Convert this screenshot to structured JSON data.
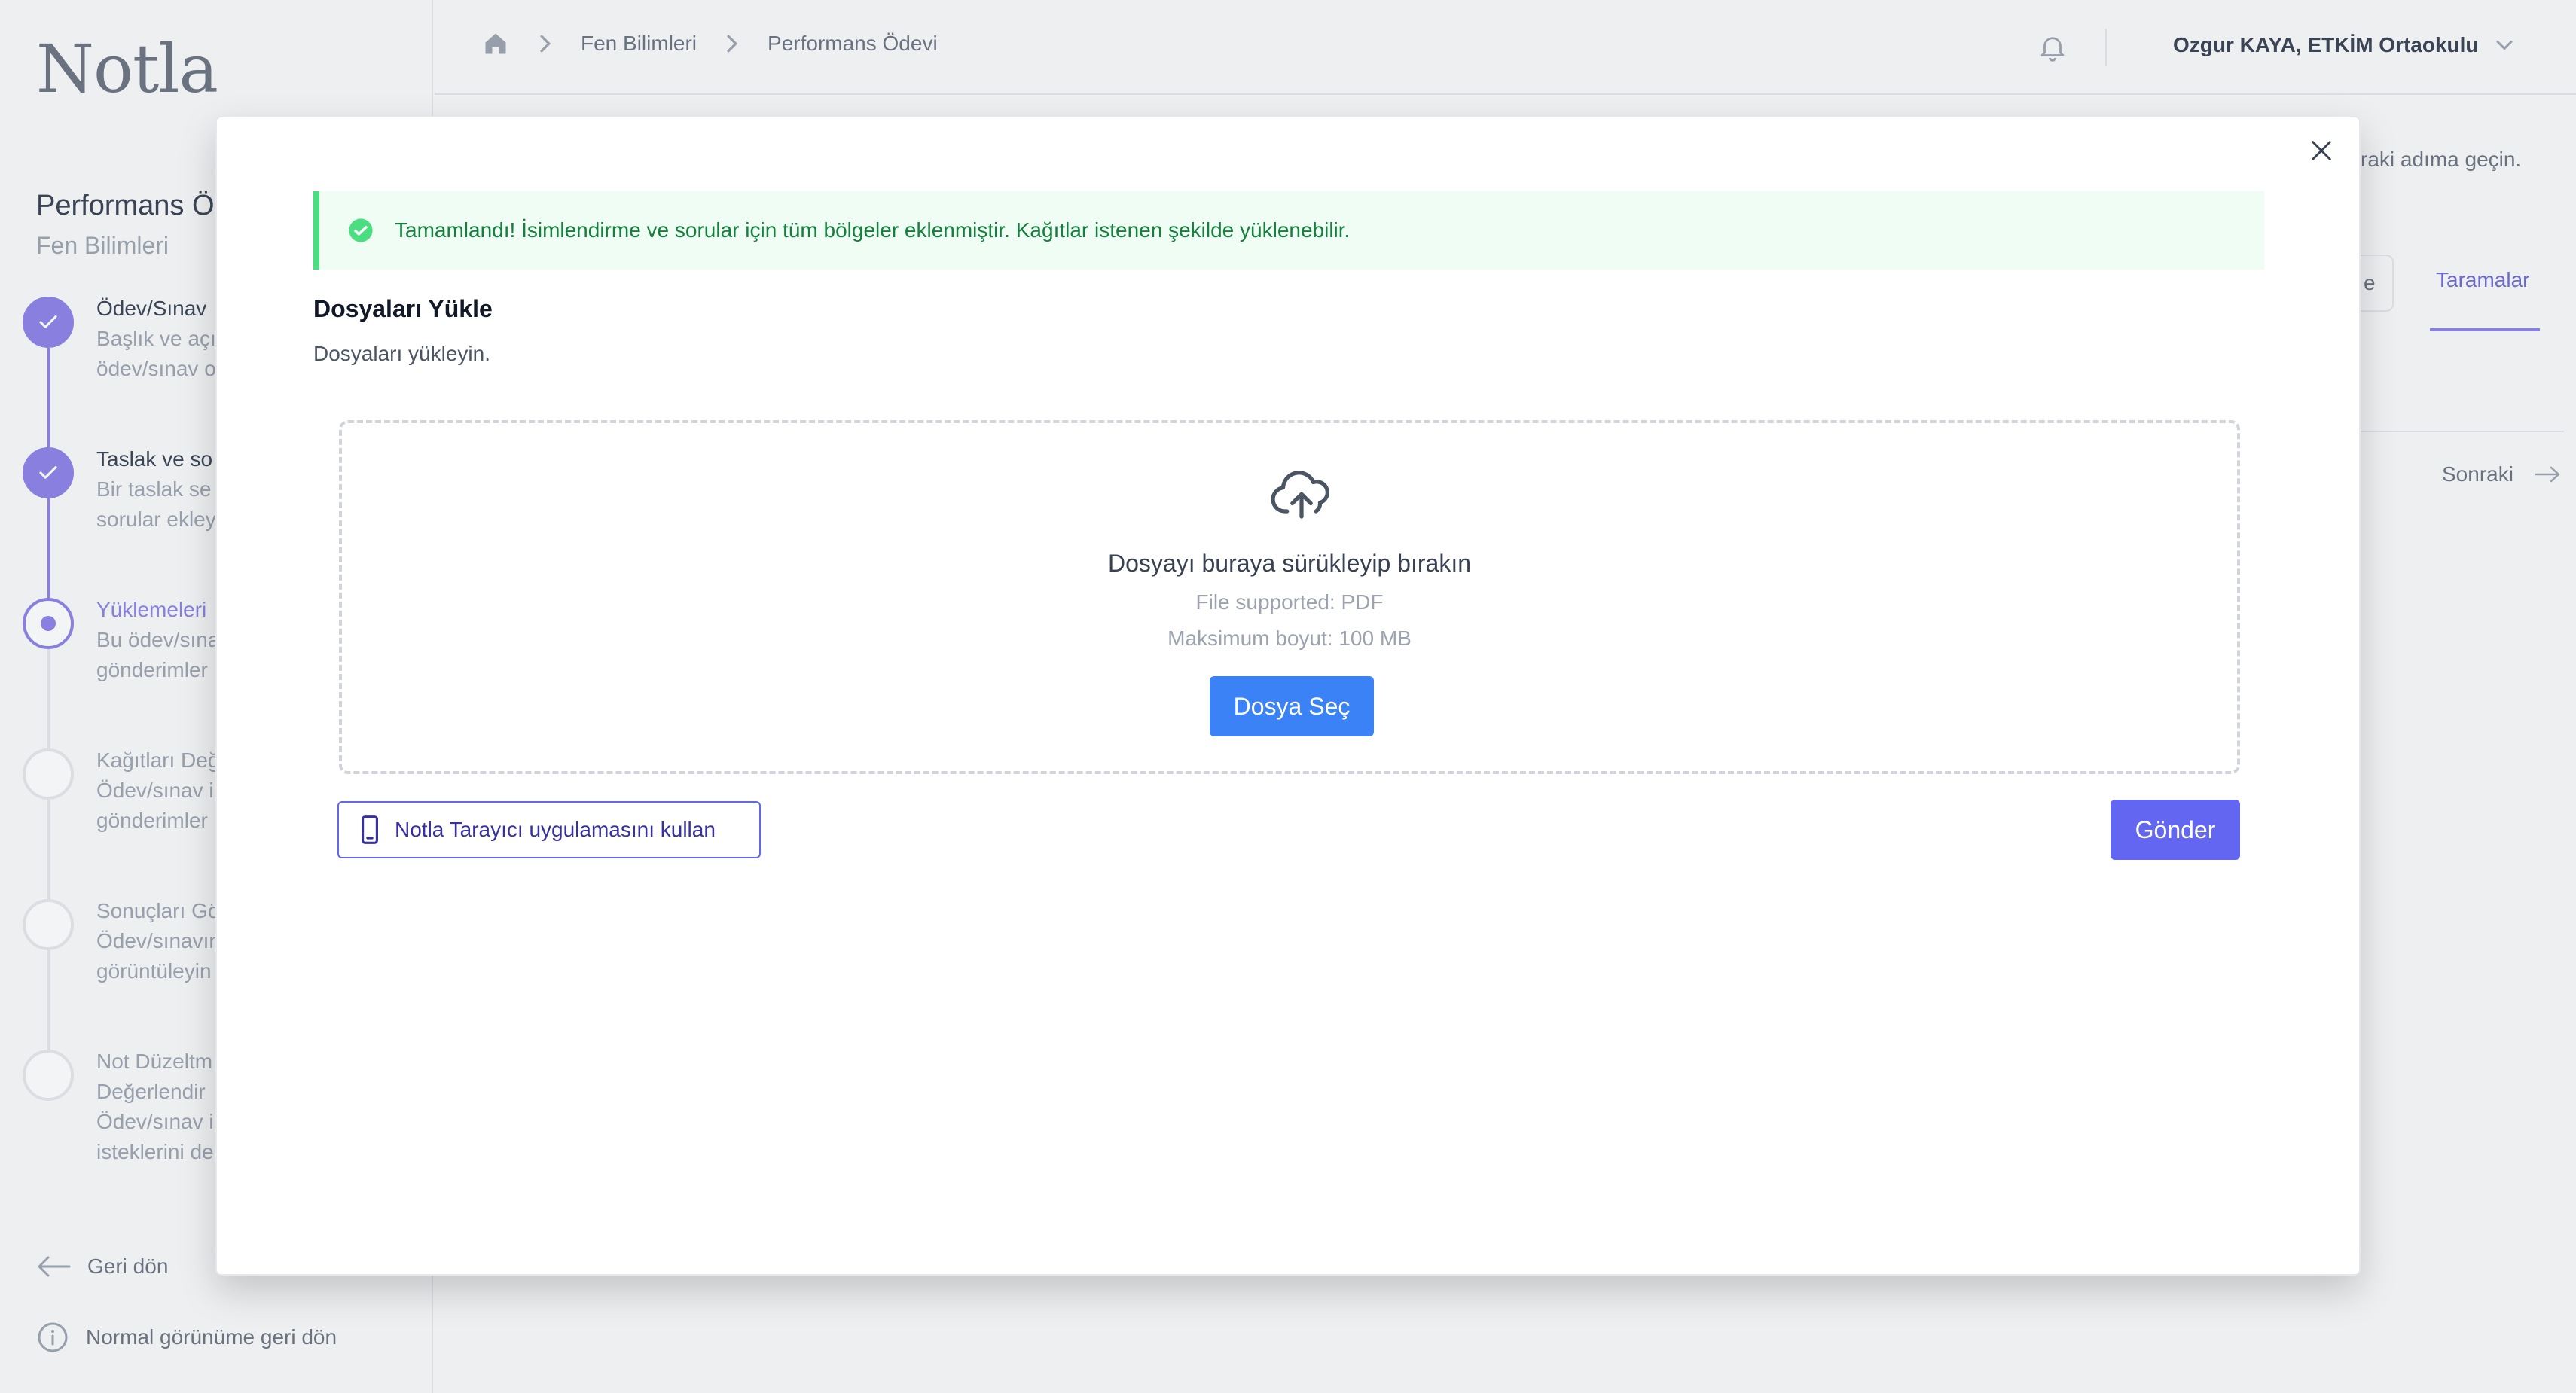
{
  "app": {
    "logo": "Notla"
  },
  "sidebar": {
    "title": "Performans Ödevi",
    "subtitle": "Fen Bilimleri",
    "steps": [
      {
        "name": "Ödev/Sınav",
        "desc1": "Başlık ve açı",
        "desc2": "ödev/sınav o",
        "status": "done"
      },
      {
        "name": "Taslak ve so",
        "desc1": "Bir taslak se",
        "desc2": "sorular ekley",
        "status": "done"
      },
      {
        "name": "Yüklemeleri",
        "desc1": "Bu ödev/sına",
        "desc2": "gönderimler",
        "status": "current"
      },
      {
        "name": "Kağıtları Değ",
        "desc1": "Ödev/sınav i",
        "desc2": "gönderimler",
        "status": "pending"
      },
      {
        "name": "Sonuçları Gö",
        "desc1": "Ödev/sınavın",
        "desc2": "görüntüleyin",
        "status": "pending"
      },
      {
        "name": "Not Düzeltm",
        "name2": "Değerlendir",
        "desc1": "Ödev/sınav i",
        "desc2": "isteklerini de",
        "status": "pending"
      }
    ],
    "back_label": "Geri dön",
    "normal_view_label": "Normal görünüme geri dön"
  },
  "header": {
    "breadcrumb": [
      "Fen Bilimleri",
      "Performans Ödevi"
    ],
    "user": "Ozgur KAYA, ETKİM Ortaokulu"
  },
  "background": {
    "hint": "raki adıma geçin.",
    "box_fragment": "e",
    "tab_label": "Taramalar",
    "next_label": "Sonraki"
  },
  "modal": {
    "alert_text": "Tamamlandı! İsimlendirme ve sorular için tüm bölgeler eklenmiştir. Kağıtlar istenen şekilde yüklenebilir.",
    "title": "Dosyaları Yükle",
    "subtitle": "Dosyaları yükleyin.",
    "dropzone": {
      "main": "Dosyayı buraya sürükleyip bırakın",
      "supported": "File supported: PDF",
      "max_size": "Maksimum boyut: 100 MB",
      "button": "Dosya Seç"
    },
    "scanner_button": "Notla Tarayıcı uygulamasını kullan",
    "submit_button": "Gönder"
  },
  "colors": {
    "accent": "#8b80e8",
    "primary_blue": "#3b82f6",
    "indigo": "#6366f1",
    "success": "#15803d"
  }
}
